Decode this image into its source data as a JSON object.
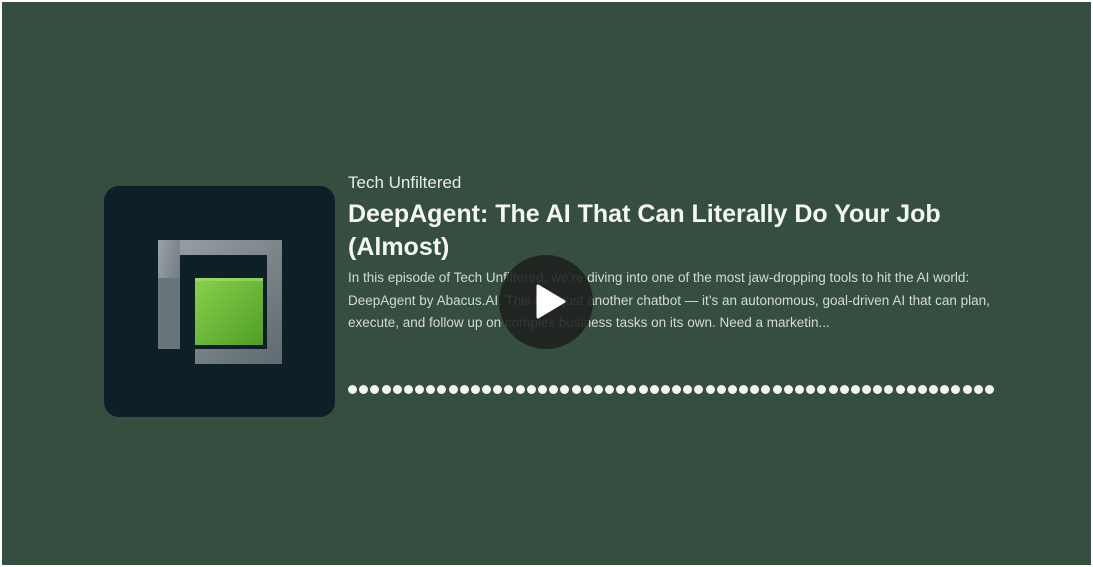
{
  "player": {
    "show_name": "Tech Unfiltered",
    "episode_title": "DeepAgent: The AI That Can Literally Do Your Job (Almost)",
    "description": "In this episode of Tech Unfiltered, we’re diving into one of the most jaw-dropping tools to hit the AI world: DeepAgent by Abacus.AI. This isn’t just another chatbot — it’s an autonomous, goal-driven AI that can plan, execute, and follow up on complex business tasks on its own. Need a marketin...",
    "play_icon": "play-icon",
    "artwork_icon": "podcast-logo",
    "progress": 0
  },
  "colors": {
    "background": "#354e3f",
    "artwork_bg": "#0e1f28",
    "logo_green": "#6fc23a",
    "logo_grey": "#7c878c",
    "waveform_dot": "#f2f4f1"
  }
}
